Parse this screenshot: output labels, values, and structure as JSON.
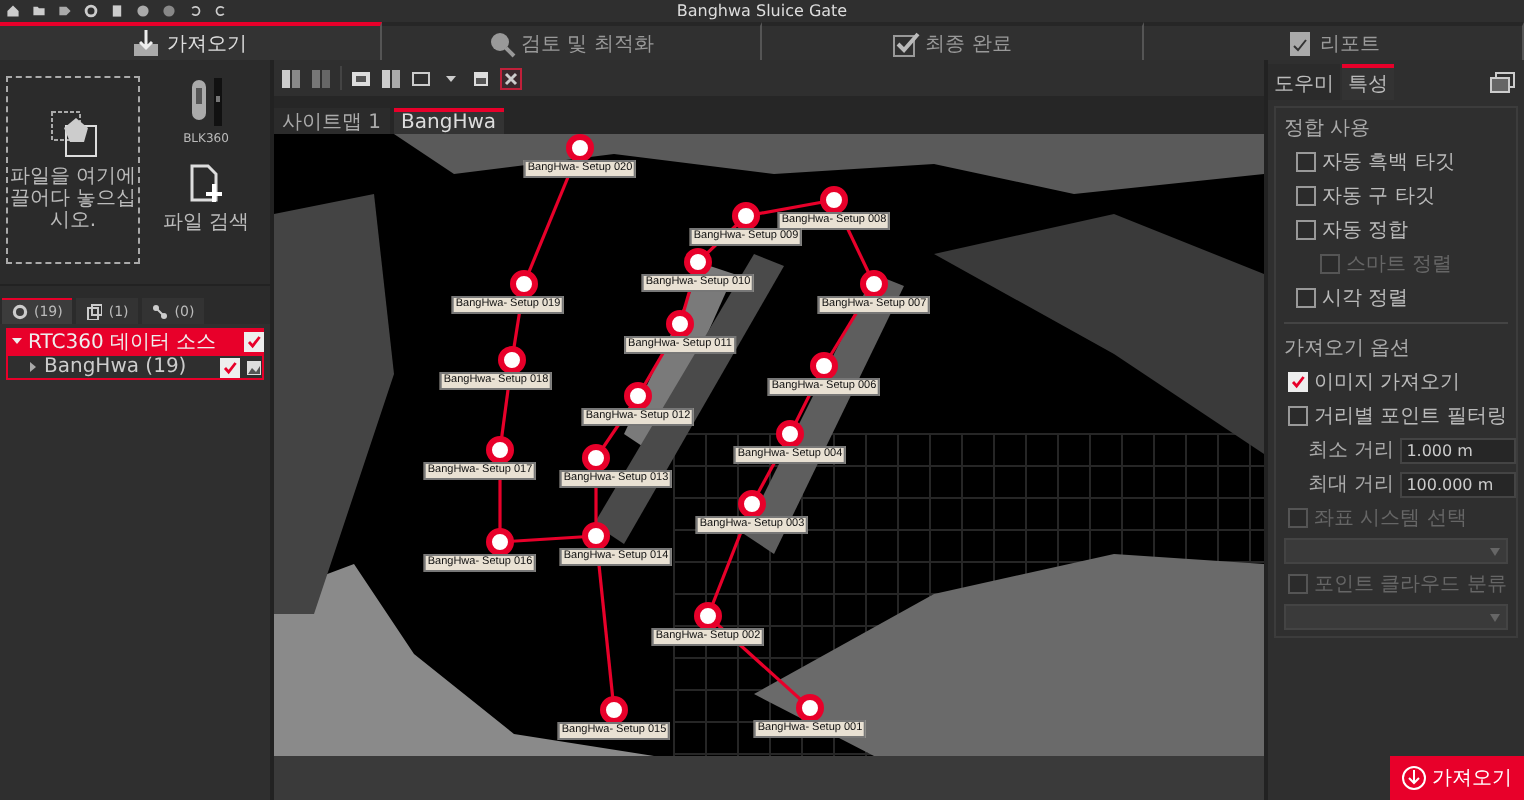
{
  "title_bar": {
    "title": "Banghwa Sluice Gate"
  },
  "steps": [
    {
      "label": "가져오기",
      "selected": true
    },
    {
      "label": "검토 및 최적화",
      "selected": false
    },
    {
      "label": "최종 완료",
      "selected": false
    },
    {
      "label": "리포트",
      "selected": false
    }
  ],
  "import_panel": {
    "drop_hint": "파일을 여기에 끌어다 놓으십시오.",
    "device": "BLK360",
    "file_button": "파일 검색"
  },
  "source_tabs": [
    {
      "count": "(19)",
      "selected": true
    },
    {
      "count": "(1)",
      "selected": false
    },
    {
      "count": "(0)",
      "selected": false
    }
  ],
  "source_tree": [
    {
      "label": "RTC360 데이터 소스",
      "checked": true,
      "expanded": true,
      "children": [
        {
          "label": "BangHwa (19)",
          "checked": true,
          "expanded": false
        }
      ]
    }
  ],
  "view_tabs": [
    {
      "label": "사이트맵 1",
      "selected": false
    },
    {
      "label": "BangHwa",
      "selected": true
    }
  ],
  "setups": [
    {
      "label": "BangHwa- Setup 020"
    },
    {
      "label": "BangHwa- Setup 008"
    },
    {
      "label": "BangHwa- Setup 009"
    },
    {
      "label": "BangHwa- Setup 010"
    },
    {
      "label": "BangHwa- Setup 019"
    },
    {
      "label": "BangHwa- Setup 007"
    },
    {
      "label": "BangHwa- Setup 011"
    },
    {
      "label": "BangHwa- Setup 018"
    },
    {
      "label": "BangHwa- Setup 006"
    },
    {
      "label": "BangHwa- Setup 012"
    },
    {
      "label": "BangHwa- Setup 004"
    },
    {
      "label": "BangHwa- Setup 017"
    },
    {
      "label": "BangHwa- Setup 013"
    },
    {
      "label": "BangHwa- Setup 003"
    },
    {
      "label": "BangHwa- Setup 014"
    },
    {
      "label": "BangHwa- Setup 016"
    },
    {
      "label": "BangHwa- Setup 002"
    },
    {
      "label": "BangHwa- Setup 015"
    },
    {
      "label": "BangHwa- Setup 001"
    }
  ],
  "right_tabs": [
    {
      "label": "도우미",
      "selected": false
    },
    {
      "label": "특성",
      "selected": true
    }
  ],
  "registration": {
    "title": "정합 사용",
    "options": [
      {
        "label": "자동 흑백 타깃",
        "checked": false,
        "disabled": false
      },
      {
        "label": "자동 구 타깃",
        "checked": false,
        "disabled": false
      },
      {
        "label": "자동 정합",
        "checked": false,
        "disabled": false,
        "children": [
          {
            "label": "스마트 정렬",
            "checked": false,
            "disabled": true
          }
        ]
      },
      {
        "label": "시각 정렬",
        "checked": false,
        "disabled": false
      }
    ]
  },
  "import_options": {
    "title": "가져오기 옵션",
    "image_import": {
      "label": "이미지 가져오기",
      "checked": true,
      "disabled": false
    },
    "distance_filter": {
      "label": "거리별 포인트 필터링",
      "checked": false,
      "disabled": false
    },
    "fields": [
      {
        "label": "최소 거리",
        "value": "1.000 m"
      },
      {
        "label": "최대 거리",
        "value": "100.000 m"
      }
    ],
    "selects": [
      {
        "label": "좌표 시스템 선택",
        "checked": false,
        "disabled": true
      },
      {
        "label": "포인트 클라우드 분류",
        "checked": false,
        "disabled": true
      }
    ]
  },
  "import_button": {
    "label": "가져오기"
  }
}
